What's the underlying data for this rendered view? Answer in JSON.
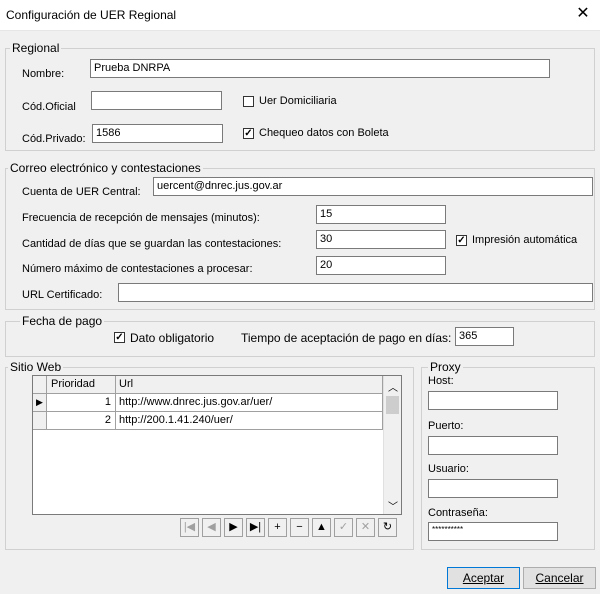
{
  "window": {
    "title": "Configuración de UER Regional",
    "close_glyph": "✕"
  },
  "regional": {
    "legend": "Regional",
    "nombre_label": "Nombre:",
    "nombre_value": "Prueba DNRPA",
    "cod_oficial_label": "Cód.Oficial",
    "cod_oficial_value": "",
    "uer_domiciliaria_label": "Uer Domiciliaria",
    "uer_domiciliaria_checked": false,
    "cod_privado_label": "Cód.Privado:",
    "cod_privado_value": "1586",
    "chequeo_label": "Chequeo datos con Boleta",
    "chequeo_checked": true
  },
  "correo": {
    "legend": "Correo electrónico y contestaciones",
    "cuenta_label": "Cuenta de UER Central:",
    "cuenta_value": "uercent@dnrec.jus.gov.ar",
    "frecuencia_label": "Frecuencia de recepción de mensajes (minutos):",
    "frecuencia_value": "15",
    "cantidad_label": "Cantidad de días que se guardan las contestaciones:",
    "cantidad_value": "30",
    "impresion_label": "Impresión automática",
    "impresion_checked": true,
    "maximo_label": "Número máximo de contestaciones a procesar:",
    "maximo_value": "20",
    "url_label": "URL Certificado:",
    "url_value": ""
  },
  "fecha_pago": {
    "legend": "Fecha de pago",
    "dato_label": "Dato obligatorio",
    "dato_checked": true,
    "tiempo_label": "Tiempo de aceptación de pago en días:",
    "tiempo_value": "365"
  },
  "sitio_web": {
    "legend": "Sitio Web",
    "columns": [
      "Prioridad",
      "Url"
    ],
    "rows": [
      {
        "prioridad": "1",
        "url": "http://www.dnrec.jus.gov.ar/uer/"
      },
      {
        "prioridad": "2",
        "url": "http://200.1.41.240/uer/"
      }
    ],
    "nav": [
      {
        "name": "first-record",
        "glyph": "|◀",
        "enabled": false
      },
      {
        "name": "prior-record",
        "glyph": "◀",
        "enabled": false
      },
      {
        "name": "next-record",
        "glyph": "▶",
        "enabled": true
      },
      {
        "name": "last-record",
        "glyph": "▶|",
        "enabled": true
      },
      {
        "name": "insert-record",
        "glyph": "+",
        "enabled": true
      },
      {
        "name": "delete-record",
        "glyph": "−",
        "enabled": true
      },
      {
        "name": "edit-record",
        "glyph": "▲",
        "enabled": true
      },
      {
        "name": "post-record",
        "glyph": "✓",
        "enabled": false
      },
      {
        "name": "cancel-record",
        "glyph": "✕",
        "enabled": false
      },
      {
        "name": "refresh-record",
        "glyph": "↻",
        "enabled": true
      }
    ]
  },
  "proxy": {
    "legend": "Proxy",
    "host_label": "Host:",
    "host_value": "",
    "puerto_label": "Puerto:",
    "puerto_value": "",
    "usuario_label": "Usuario:",
    "usuario_value": "",
    "contrasena_label": "Contraseña:",
    "contrasena_value": "**********"
  },
  "buttons": {
    "aceptar": "Aceptar",
    "cancelar": "Cancelar"
  }
}
